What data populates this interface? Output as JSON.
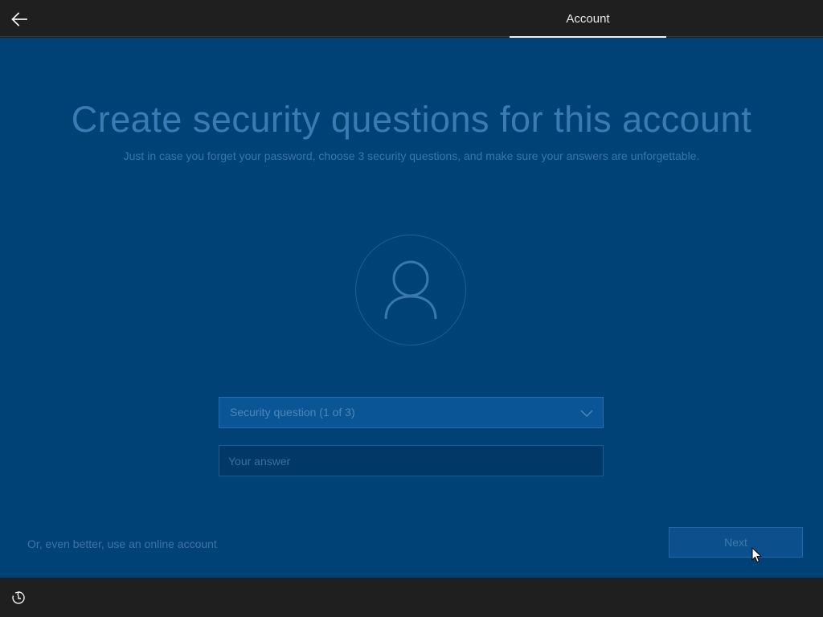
{
  "header": {
    "back_icon": "arrow-left-icon",
    "tab_label": "Account"
  },
  "main": {
    "title": "Create security questions for this account",
    "subtitle": "Just in case you forget your password, choose 3 security questions, and make sure your answers are unforgettable.",
    "avatar_icon": "user-icon",
    "security_question": {
      "selected": "Security question (1 of 3)",
      "chevron_icon": "chevron-down-icon"
    },
    "answer": {
      "value": "",
      "placeholder": "Your answer"
    },
    "online_account_link": "Or, even better, use an online account",
    "next_label": "Next"
  },
  "footer": {
    "ease_of_access_icon": "ease-of-access-icon"
  },
  "colors": {
    "background": "#004275",
    "chrome": "#1f1f1f",
    "title": "#3a7bb3",
    "dropdown": "#0a5596",
    "input": "#003867"
  }
}
